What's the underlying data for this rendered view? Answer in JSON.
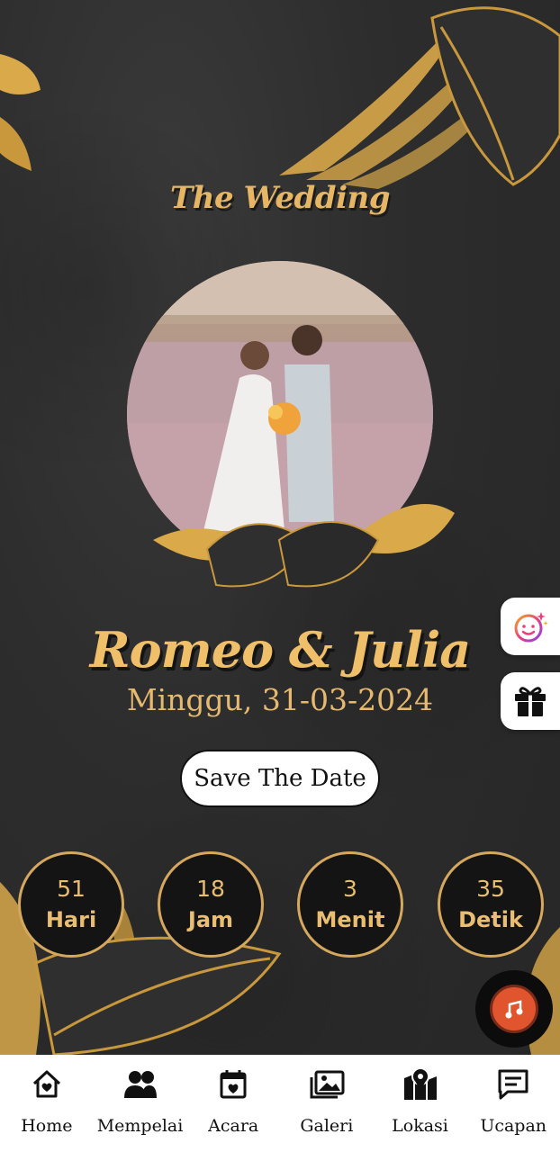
{
  "hero": {
    "title": "The Wedding",
    "names": "Romeo & Julia",
    "date": "Minggu, 31-03-2024",
    "save_button_label": "Save The Date"
  },
  "countdown": [
    {
      "value": "51",
      "unit": "Hari"
    },
    {
      "value": "18",
      "unit": "Jam"
    },
    {
      "value": "3",
      "unit": "Menit"
    },
    {
      "value": "35",
      "unit": "Detik"
    }
  ],
  "floating": {
    "filter_icon": "face-sparkle-icon",
    "gift_icon": "gift-icon",
    "music_icon": "music-disc-icon"
  },
  "nav": [
    {
      "label": "Home",
      "icon": "home-heart-icon"
    },
    {
      "label": "Mempelai",
      "icon": "people-icon"
    },
    {
      "label": "Acara",
      "icon": "calendar-heart-icon"
    },
    {
      "label": "Galeri",
      "icon": "gallery-icon"
    },
    {
      "label": "Lokasi",
      "icon": "map-pin-icon"
    },
    {
      "label": "Ucapan",
      "icon": "message-icon"
    }
  ],
  "colors": {
    "gold": "#e7b665",
    "background": "#2b2b2b",
    "music_accent": "#e0552d"
  }
}
